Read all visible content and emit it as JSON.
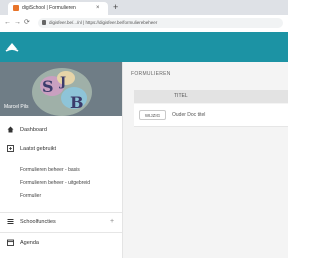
{
  "browser": {
    "tab_title": "digiSchool | Formulieren",
    "tab_close": "×",
    "new_tab": "+",
    "url": "digisfeer.be/.../nl | https://digisfeer.be/formulierebeheer"
  },
  "colors": {
    "accent": "#1c93a4",
    "profile_bg": "#6f7d86"
  },
  "sidebar": {
    "user_name": "Marcel Pils",
    "items": [
      {
        "label": "Dashboard",
        "icon": "home-icon"
      },
      {
        "label": "Laatst gebruikt",
        "icon": "history-icon"
      }
    ],
    "recent": [
      "Formulieren beheer - basis",
      "Formulieren beheer - uitgebreid",
      "Formulier"
    ],
    "sections": [
      {
        "label": "Schoolfuncties",
        "icon": "list-icon",
        "expand": "+"
      },
      {
        "label": "Agenda",
        "icon": "calendar-icon"
      }
    ]
  },
  "main": {
    "page_title": "FORMULIEREN",
    "table": {
      "columns": [
        "TITEL"
      ],
      "rows": [
        {
          "action": "WIJZIG",
          "title": "Ouder Doc titel"
        }
      ]
    }
  }
}
